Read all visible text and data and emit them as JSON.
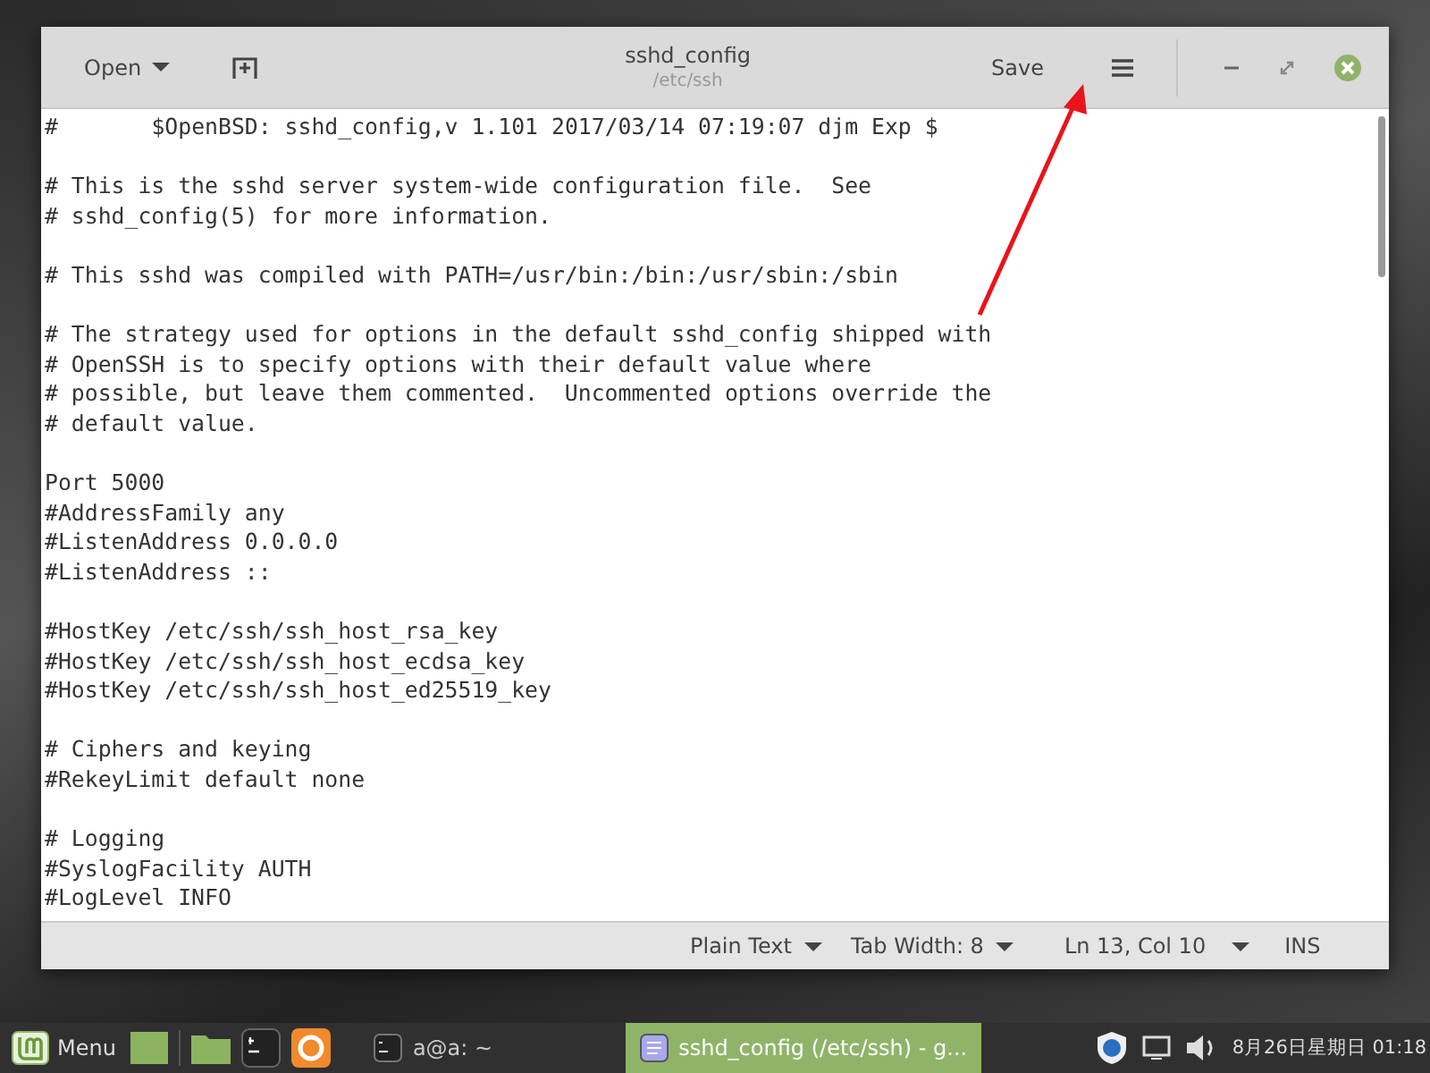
{
  "window": {
    "title": "sshd_config",
    "subtitle": "/etc/ssh",
    "open_button": "Open",
    "save_button": "Save"
  },
  "editor": {
    "blocks": [
      {
        "lines": [
          "#\t$OpenBSD: sshd_config,v 1.101 2017/03/14 07:19:07 djm Exp $"
        ]
      },
      {
        "lines": [
          "# This is the sshd server system-wide configuration file.  See",
          "# sshd_config(5) for more information."
        ]
      },
      {
        "lines": [
          "# This sshd was compiled with PATH=/usr/bin:/bin:/usr/sbin:/sbin"
        ]
      },
      {
        "lines": [
          "# The strategy used for options in the default sshd_config shipped with",
          "# OpenSSH is to specify options with their default value where",
          "# possible, but leave them commented.  Uncommented options override the",
          "# default value."
        ]
      },
      {
        "lines": [
          "Port 5000",
          "#AddressFamily any",
          "#ListenAddress 0.0.0.0",
          "#ListenAddress ::"
        ]
      },
      {
        "lines": [
          "#HostKey /etc/ssh/ssh_host_rsa_key",
          "#HostKey /etc/ssh/ssh_host_ecdsa_key",
          "#HostKey /etc/ssh/ssh_host_ed25519_key"
        ]
      },
      {
        "lines": [
          "# Ciphers and keying",
          "#RekeyLimit default none"
        ]
      },
      {
        "lines": [
          "# Logging",
          "#SyslogFacility AUTH",
          "#LogLevel INFO"
        ]
      }
    ]
  },
  "status_bar": {
    "language": "Plain Text",
    "tab_width": "Tab Width: 8",
    "position": "Ln 13, Col 10",
    "mode": "INS"
  },
  "taskbar": {
    "menu": "Menu",
    "windows": [
      {
        "kind": "terminal",
        "label": "a@a: ~",
        "selected": false
      },
      {
        "kind": "editor",
        "label": "sshd_config (/etc/ssh) - g...",
        "selected": true
      }
    ],
    "clock": "8月26日星期日 01:18"
  }
}
